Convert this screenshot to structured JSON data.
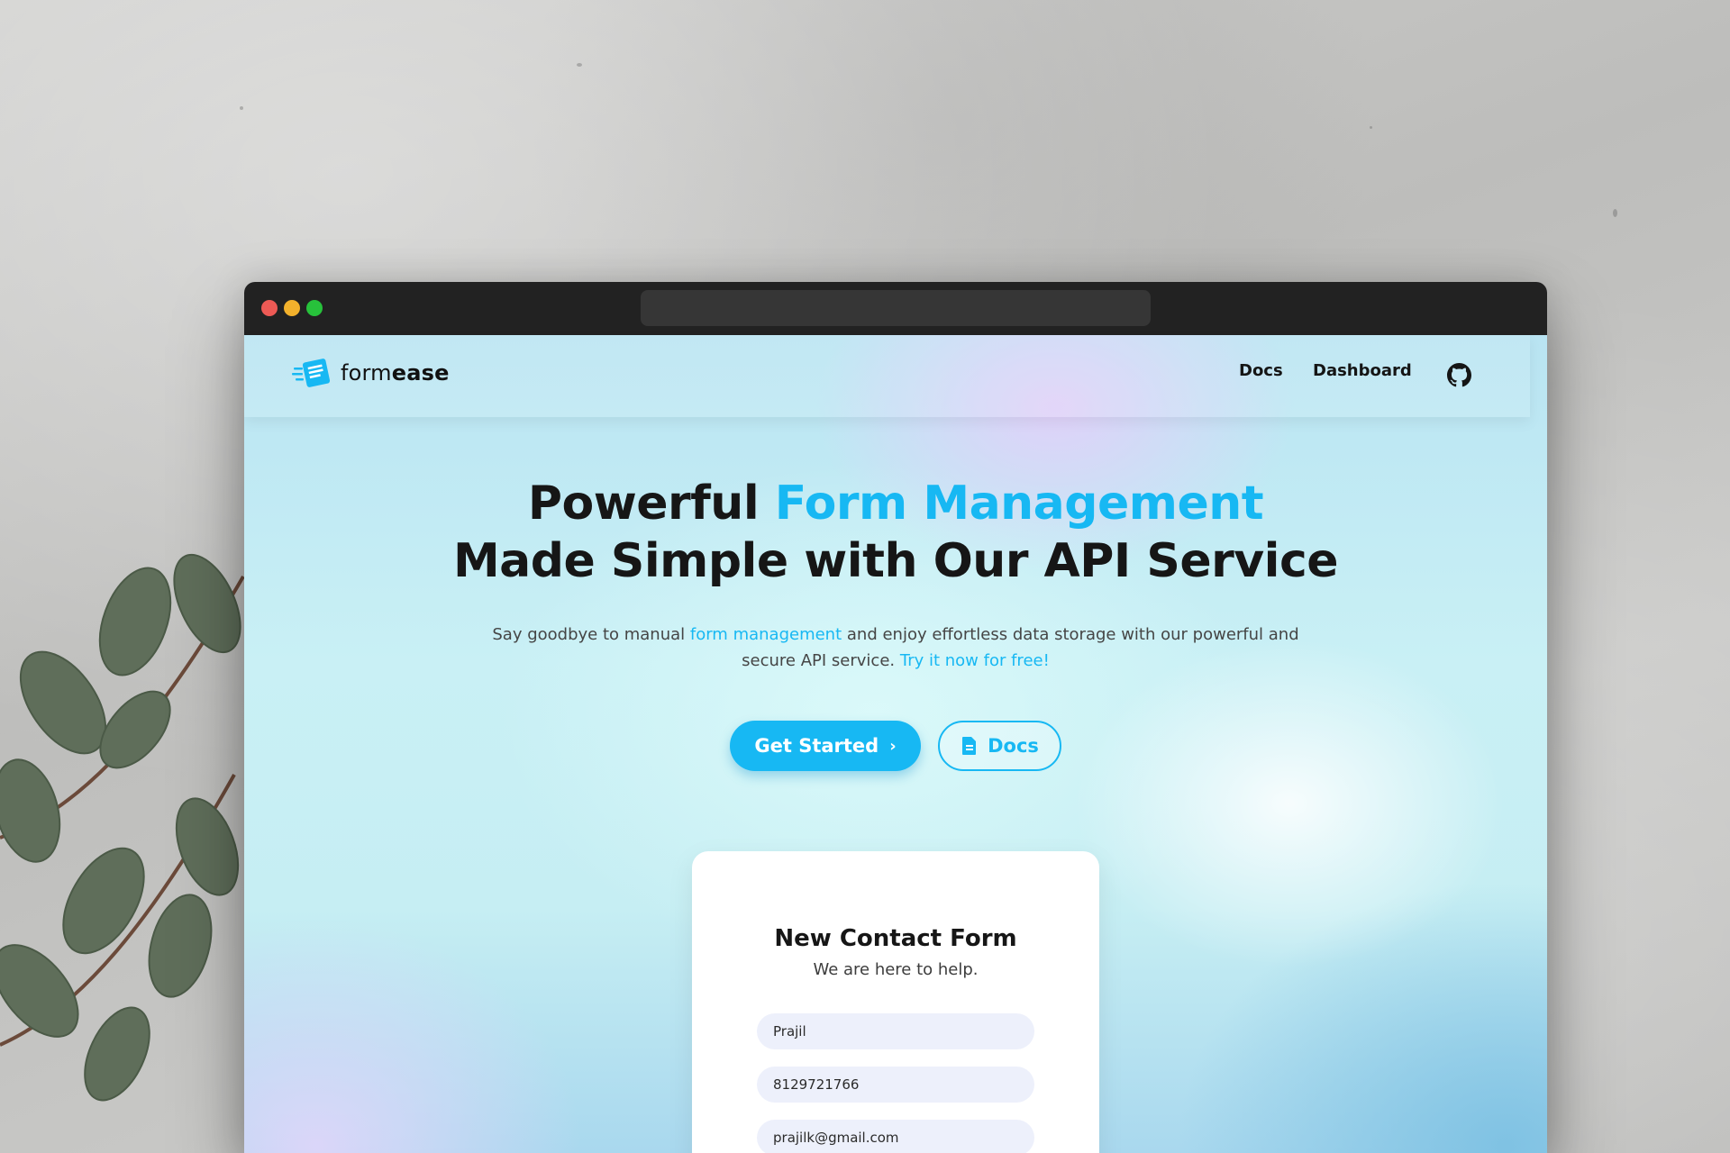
{
  "browser": {
    "url": ""
  },
  "nav": {
    "logo_prefix": "form",
    "logo_suffix": "ease",
    "links": [
      {
        "label": "Docs"
      },
      {
        "label": "Dashboard"
      }
    ],
    "github_icon": "github-icon"
  },
  "hero": {
    "title_part1": "Powerful ",
    "title_accent": "Form Management",
    "title_line2": "Made Simple with Our API Service",
    "sub_part1": "Say goodbye to manual ",
    "sub_link": "form management",
    "sub_part2": " and enjoy effortless data storage with our powerful and secure API service. ",
    "sub_cta": "Try it now for free!",
    "primary_button": "Get Started",
    "primary_icon": "chevron-right-icon",
    "secondary_button": "Docs",
    "secondary_icon": "document-icon"
  },
  "contact_form": {
    "title": "New Contact Form",
    "subtitle": "We are here to help.",
    "fields": [
      {
        "value": "Prajil"
      },
      {
        "value": "8129721766"
      },
      {
        "value": "prajilk@gmail.com"
      }
    ]
  },
  "colors": {
    "accent": "#17b8f3",
    "titlebar": "#222222",
    "text_dark": "#161616"
  }
}
